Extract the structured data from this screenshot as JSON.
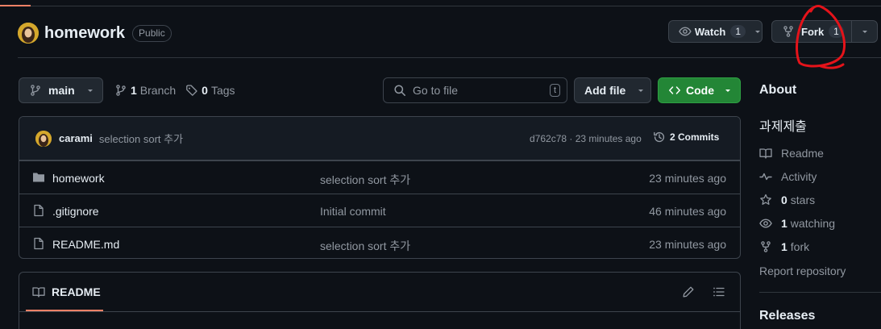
{
  "repo": {
    "name": "homework",
    "visibility": "Public"
  },
  "actions": {
    "watch_label": "Watch",
    "watch_count": "1",
    "fork_label": "Fork",
    "fork_count": "1"
  },
  "toolbar": {
    "branch_name": "main",
    "branch_count": "1",
    "branch_label": "Branch",
    "tag_count": "0",
    "tag_label": "Tags",
    "search_placeholder": "Go to file",
    "search_shortcut": "t",
    "add_file_label": "Add file",
    "code_label": "Code"
  },
  "latest_commit": {
    "author": "carami",
    "message": "selection sort 추가",
    "meta": "d762c78 · 23 minutes ago",
    "commits_count_label": "2 Commits"
  },
  "files": [
    {
      "type": "folder",
      "name": "homework",
      "message": "selection sort 추가",
      "time": "23 minutes ago"
    },
    {
      "type": "file",
      "name": ".gitignore",
      "message": "Initial commit",
      "time": "46 minutes ago"
    },
    {
      "type": "file",
      "name": "README.md",
      "message": "selection sort 추가",
      "time": "23 minutes ago"
    }
  ],
  "readme": {
    "tab_label": "README"
  },
  "about": {
    "title": "About",
    "description": "과제제출",
    "readme_label": "Readme",
    "activity_label": "Activity",
    "stars_count": "0",
    "stars_label": "stars",
    "watching_count": "1",
    "watching_label": "watching",
    "fork_count": "1",
    "fork_label": "fork",
    "report_label": "Report repository",
    "releases_title": "Releases"
  },
  "colors": {
    "background": "#0d1117",
    "code_button": "#238636",
    "tab_accent": "#f78166",
    "annotation": "#e5131a"
  }
}
